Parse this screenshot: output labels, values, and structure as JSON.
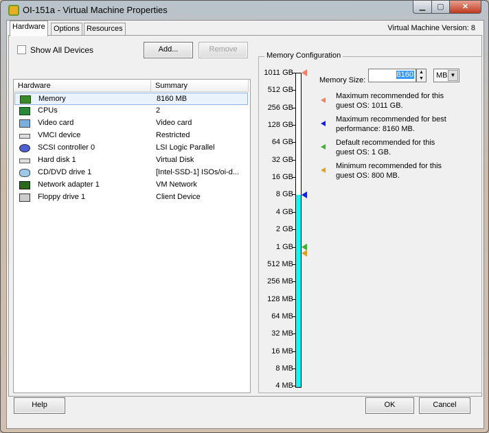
{
  "window": {
    "title": "OI-151a - Virtual Machine Properties",
    "minimize": "▁",
    "maximize": "▢",
    "close": "✕"
  },
  "tabs": [
    {
      "label": "Hardware",
      "active": true
    },
    {
      "label": "Options"
    },
    {
      "label": "Resources"
    }
  ],
  "vm_version": "Virtual Machine Version: 8",
  "show_all_devices": {
    "label": "Show All Devices",
    "checked": false
  },
  "add_label": "Add...",
  "remove_label": "Remove",
  "table": {
    "columns": [
      "Hardware",
      "Summary"
    ],
    "rows": [
      {
        "icon": "memory-icon",
        "name": "Memory",
        "summary": "8160 MB",
        "selected": true
      },
      {
        "icon": "cpu-icon",
        "name": "CPUs",
        "summary": "2"
      },
      {
        "icon": "monitor-icon",
        "name": "Video card",
        "summary": "Video card"
      },
      {
        "icon": "device-icon",
        "name": "VMCI device",
        "summary": "Restricted"
      },
      {
        "icon": "scsi-icon",
        "name": "SCSI controller 0",
        "summary": "LSI Logic Parallel"
      },
      {
        "icon": "disk-icon",
        "name": "Hard disk 1",
        "summary": "Virtual Disk"
      },
      {
        "icon": "cd-icon",
        "name": "CD/DVD drive 1",
        "summary": "[Intel-SSD-1] ISOs/oi-d..."
      },
      {
        "icon": "network-icon",
        "name": "Network adapter 1",
        "summary": "VM Network"
      },
      {
        "icon": "floppy-icon",
        "name": "Floppy drive 1",
        "summary": "Client Device"
      }
    ]
  },
  "memory": {
    "group_title": "Memory Configuration",
    "size_label": "Memory Size:",
    "size_value": "8160",
    "unit": "MB",
    "scale_labels": [
      "1011 GB",
      "512 GB",
      "256 GB",
      "128 GB",
      "64 GB",
      "32 GB",
      "16 GB",
      "8 GB",
      "4 GB",
      "2 GB",
      "1 GB",
      "512 MB",
      "256 MB",
      "128 MB",
      "64 MB",
      "32 MB",
      "16 MB",
      "8 MB",
      "4 MB"
    ],
    "current_mb": 8160,
    "fill_color": "#00ffff",
    "markers": [
      {
        "name": "max-guest-os",
        "mb": 1035264,
        "color": "#f08060",
        "text": "Maximum recommended for this guest OS: 1011 GB."
      },
      {
        "name": "max-best-performance",
        "mb": 8160,
        "color": "#1020e0",
        "text": "Maximum recommended for best performance: 8160 MB."
      },
      {
        "name": "default-guest-os",
        "mb": 1024,
        "color": "#40b030",
        "text": "Default recommended for this guest OS: 1 GB."
      },
      {
        "name": "min-guest-os",
        "mb": 800,
        "color": "#e0a020",
        "text": "Minimum recommended for this guest OS: 800 MB."
      }
    ]
  },
  "buttons": {
    "help": "Help",
    "ok": "OK",
    "cancel": "Cancel"
  }
}
